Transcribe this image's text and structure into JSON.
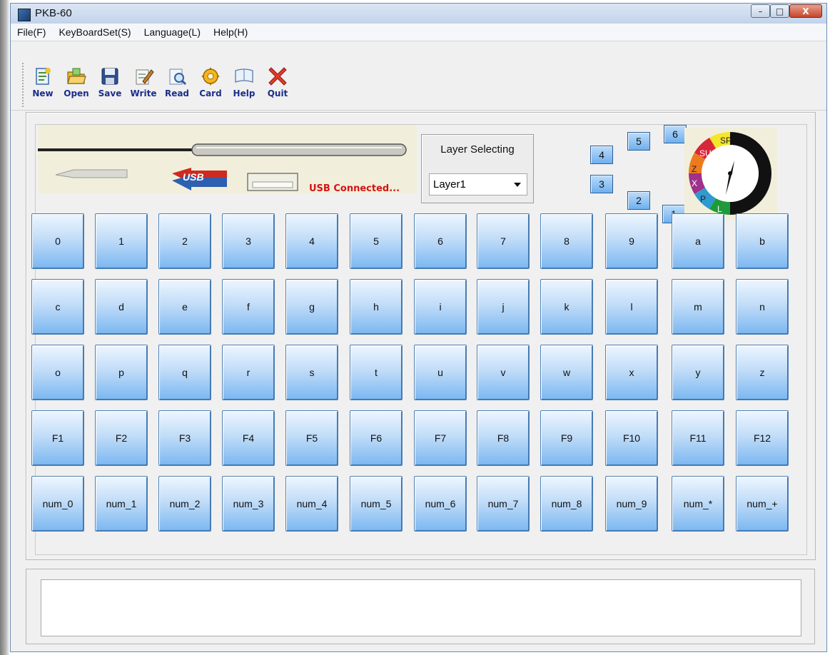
{
  "window": {
    "title": "PKB-60",
    "controls": {
      "minimize": "–",
      "maximize": "□",
      "close": "X"
    }
  },
  "menu": [
    "File(F)",
    "KeyBoardSet(S)",
    "Language(L)",
    "Help(H)"
  ],
  "toolbar": [
    {
      "label": "New",
      "icon": "new-icon"
    },
    {
      "label": "Open",
      "icon": "open-icon"
    },
    {
      "label": "Save",
      "icon": "save-icon"
    },
    {
      "label": "Write",
      "icon": "write-icon"
    },
    {
      "label": "Read",
      "icon": "read-icon"
    },
    {
      "label": "Card",
      "icon": "card-icon"
    },
    {
      "label": "Help",
      "icon": "help-icon"
    },
    {
      "label": "Quit",
      "icon": "quit-icon"
    }
  ],
  "usb": {
    "logo_text": "USB",
    "status": "USB Connected..."
  },
  "layer": {
    "label": "Layer Selecting",
    "selected": "Layer1",
    "buttons": [
      "1",
      "2",
      "3",
      "4",
      "5",
      "6"
    ]
  },
  "dial": {
    "segments": [
      "SP",
      "SU",
      "Z",
      "X",
      "P",
      "L"
    ]
  },
  "keys": [
    [
      "0",
      "1",
      "2",
      "3",
      "4",
      "5",
      "6",
      "7",
      "8",
      "9",
      "a",
      "b"
    ],
    [
      "c",
      "d",
      "e",
      "f",
      "g",
      "h",
      "i",
      "j",
      "k",
      "l",
      "m",
      "n"
    ],
    [
      "o",
      "p",
      "q",
      "r",
      "s",
      "t",
      "u",
      "v",
      "w",
      "x",
      "y",
      "z"
    ],
    [
      "F1",
      "F2",
      "F3",
      "F4",
      "F5",
      "F6",
      "F7",
      "F8",
      "F9",
      "F10",
      "F11",
      "F12"
    ],
    [
      "num_0",
      "num_1",
      "num_2",
      "num_3",
      "num_4",
      "num_5",
      "num_6",
      "num_7",
      "num_8",
      "num_9",
      "num_*",
      "num_+"
    ]
  ],
  "log": {
    "text": ""
  },
  "colors": {
    "key_top": "#eef6ff",
    "key_bottom": "#7bb7f1",
    "status_red": "#d41414",
    "toolbar_label": "#1a2e8a"
  }
}
